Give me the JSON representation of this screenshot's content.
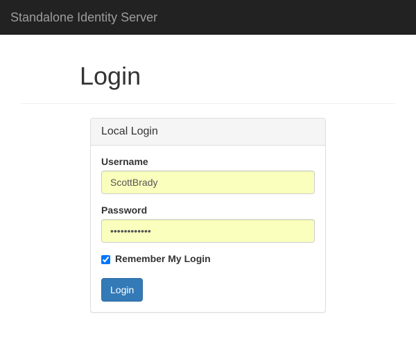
{
  "navbar": {
    "brand": "Standalone Identity Server"
  },
  "page": {
    "title": "Login"
  },
  "panel": {
    "heading": "Local Login"
  },
  "form": {
    "username": {
      "label": "Username",
      "value": "ScottBrady"
    },
    "password": {
      "label": "Password",
      "value": "••••••••••••"
    },
    "remember": {
      "label": "Remember My Login",
      "checked": true
    },
    "submit": {
      "label": "Login"
    }
  }
}
